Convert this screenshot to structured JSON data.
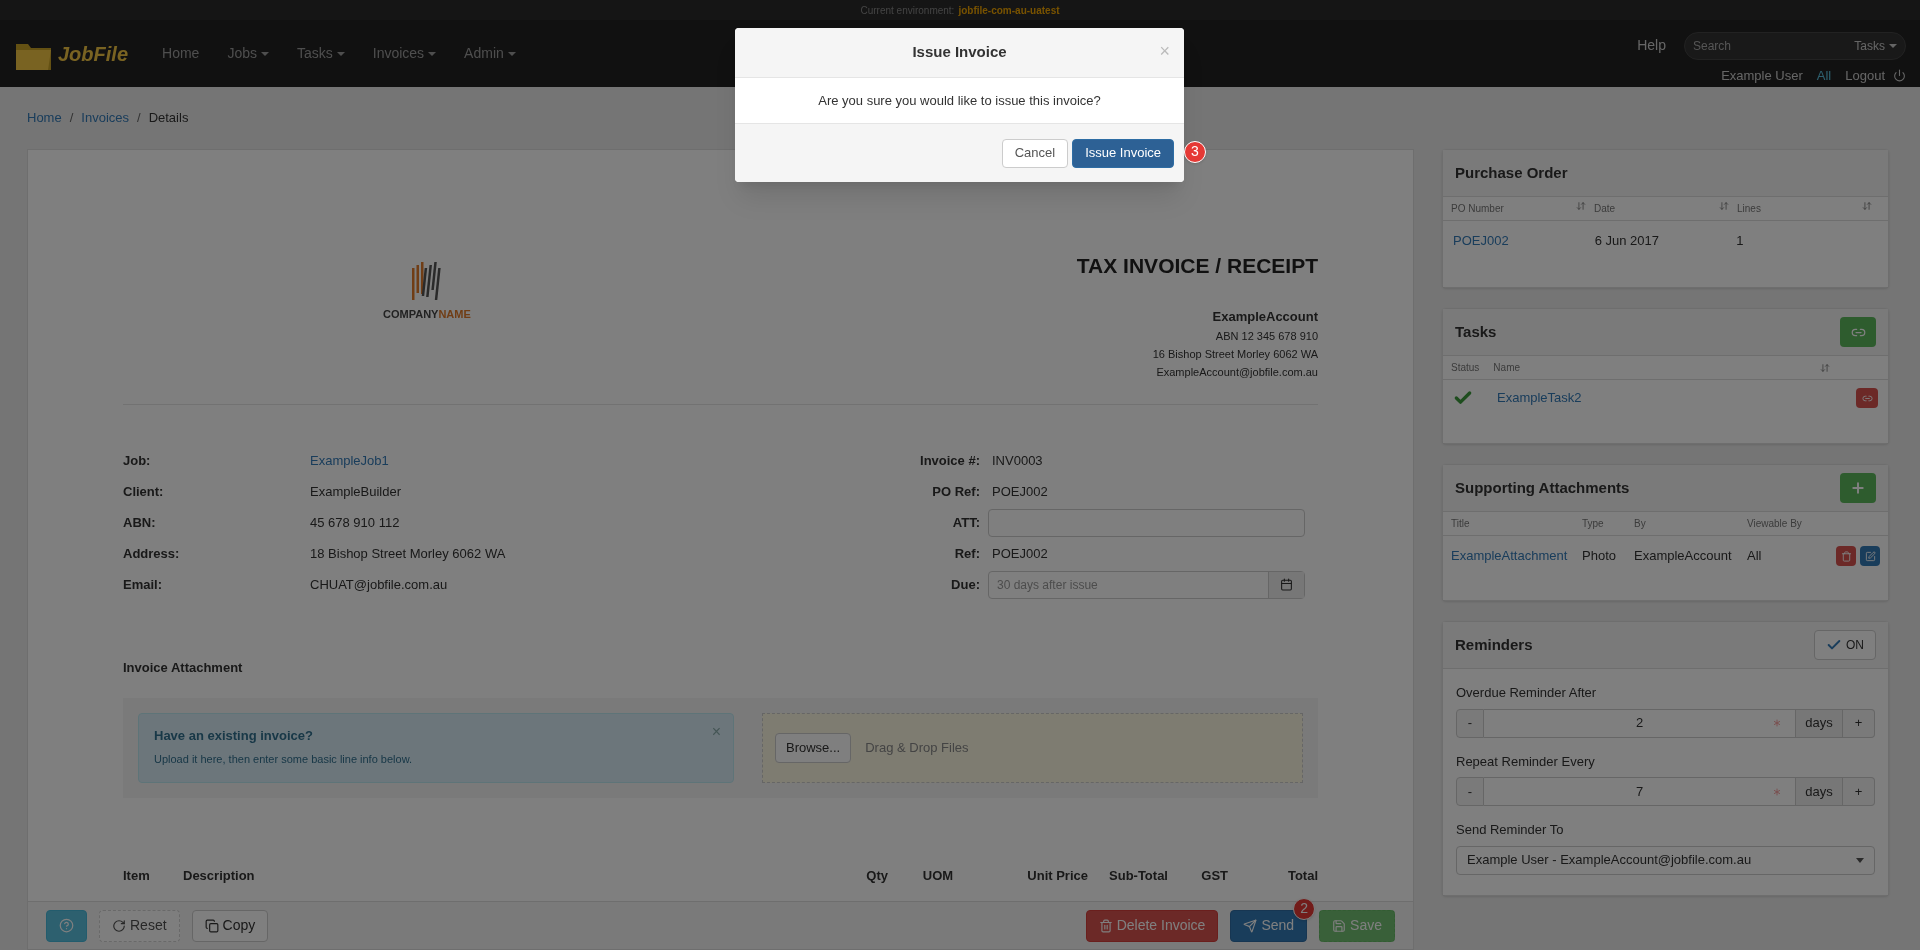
{
  "environment": {
    "label": "Current environment:",
    "value": "jobfile-com-au-uatest"
  },
  "nav": {
    "brand": "JobFile",
    "items": [
      {
        "label": "Home",
        "dropdown": false
      },
      {
        "label": "Jobs",
        "dropdown": true
      },
      {
        "label": "Tasks",
        "dropdown": true
      },
      {
        "label": "Invoices",
        "dropdown": true
      },
      {
        "label": "Admin",
        "dropdown": true
      }
    ],
    "help": "Help",
    "search_placeholder": "Search",
    "search_scope": "Tasks",
    "user": "Example User",
    "all": "All",
    "logout": "Logout"
  },
  "breadcrumb": [
    "Home",
    "Invoices",
    "Details"
  ],
  "breadcrumb_separator": "/",
  "invoice": {
    "logo": {
      "first": "COMPANY",
      "second": "NAME"
    },
    "title": "TAX INVOICE / RECEIPT",
    "account": {
      "name": "ExampleAccount",
      "lines": [
        "ABN 12 345 678 910",
        "16 Bishop Street Morley 6062 WA",
        "ExampleAccount@jobfile.com.au"
      ]
    },
    "left_fields": [
      {
        "label": "Job:",
        "value": "ExampleJob1",
        "kind": "link"
      },
      {
        "label": "Client:",
        "value": "ExampleBuilder",
        "kind": "text"
      },
      {
        "label": "ABN:",
        "value": "45 678 910 112",
        "kind": "text"
      },
      {
        "label": "Address:",
        "value": "18 Bishop Street Morley 6062 WA",
        "kind": "text"
      },
      {
        "label": "Email:",
        "value": "CHUAT@jobfile.com.au",
        "kind": "text"
      }
    ],
    "right_fields": [
      {
        "label": "Invoice #:",
        "value": "INV0003",
        "kind": "text"
      },
      {
        "label": "PO Ref:",
        "value": "POEJ002",
        "kind": "text"
      },
      {
        "label": "ATT:",
        "kind": "input"
      },
      {
        "label": "Ref:",
        "value": "POEJ002",
        "kind": "text"
      },
      {
        "label": "Due:",
        "placeholder": "30 days after issue",
        "kind": "date"
      }
    ],
    "attachment": {
      "heading": "Invoice Attachment",
      "alert_title": "Have an existing invoice?",
      "alert_text": "Upload it here, then enter some basic line info below.",
      "alert_close": "×",
      "browse": "Browse...",
      "drop": "Drag & Drop Files"
    },
    "columns": [
      "Item",
      "Description",
      "Qty",
      "UOM",
      "Unit Price",
      "Sub-Total",
      "GST",
      "Total"
    ]
  },
  "toolbar": [
    {
      "kind": "help",
      "disabled": false
    },
    {
      "kind": "reset",
      "label": "Reset",
      "disabled": true
    },
    {
      "kind": "copy",
      "label": "Copy",
      "disabled": false
    },
    {
      "kind": "delete",
      "label": "Delete Invoice",
      "disabled": false
    },
    {
      "kind": "send",
      "label": "Send",
      "disabled": false,
      "badge": "2"
    },
    {
      "kind": "save",
      "label": "Save",
      "disabled": true
    }
  ],
  "purchase_order": {
    "title": "Purchase Order",
    "columns": [
      "PO Number",
      "Date",
      "Lines"
    ],
    "rows": [
      [
        "POEJ002",
        "6 Jun 2017",
        "1"
      ]
    ]
  },
  "tasks": {
    "title": "Tasks",
    "columns": [
      "Status",
      "Name"
    ],
    "rows": [
      {
        "complete": true,
        "name": "ExampleTask2"
      }
    ]
  },
  "attachments": {
    "title": "Supporting Attachments",
    "columns": [
      "Title",
      "Type",
      "By",
      "Viewable By"
    ],
    "rows": [
      [
        "ExampleAttachment",
        "Photo",
        "ExampleAccount",
        "All"
      ]
    ]
  },
  "reminders": {
    "title": "Reminders",
    "on": true,
    "on_label": "ON",
    "steppers": [
      {
        "label": "Overdue Reminder After",
        "minus": "-",
        "value": "2",
        "unit": "days",
        "plus": "+"
      },
      {
        "label": "Repeat Reminder Every",
        "minus": "-",
        "value": "7",
        "unit": "days",
        "plus": "+"
      }
    ],
    "send_to_label": "Send Reminder To",
    "send_to": "Example User - ExampleAccount@jobfile.com.au"
  },
  "modal": {
    "title": "Issue Invoice",
    "close": "×",
    "message": "Are you sure you would like to issue this invoice?",
    "cancel": "Cancel",
    "confirm": "Issue Invoice",
    "badge": "3"
  }
}
